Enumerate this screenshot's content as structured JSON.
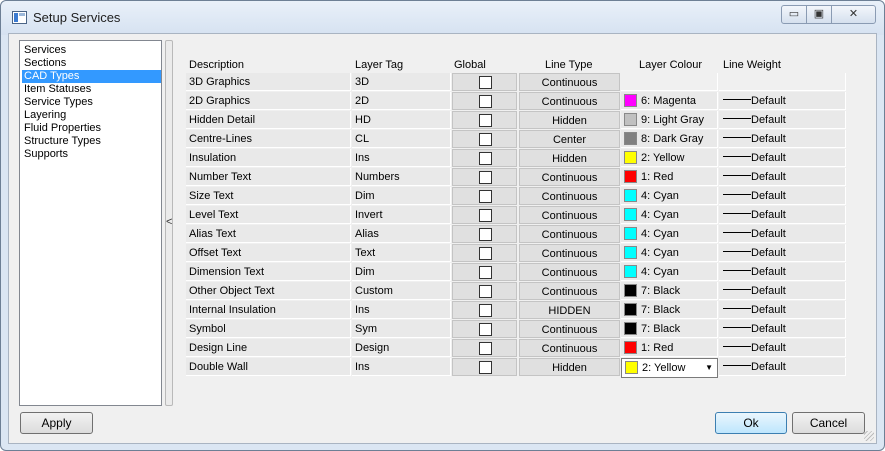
{
  "window": {
    "title": "Setup Services",
    "minimize_glyph": "▭",
    "maximize_glyph": "▣",
    "close_glyph": "✕",
    "icon": "window-app-icon"
  },
  "nav": {
    "items": [
      "Services",
      "Sections",
      "CAD Types",
      "Item Statuses",
      "Service Types",
      "Layering",
      "Fluid Properties",
      "Structure Types",
      "Supports"
    ],
    "selected": "CAD Types"
  },
  "splitter": {
    "glyph": "<"
  },
  "grid": {
    "headers": {
      "description": "Description",
      "layer_tag": "Layer Tag",
      "global": "Global",
      "line_type": "Line Type",
      "layer_colour": "Layer Colour",
      "line_weight": "Line Weight"
    },
    "rows": [
      {
        "description": "3D Graphics",
        "layer_tag": "3D",
        "line_type": "Continuous",
        "colour": "",
        "swatch": "",
        "weight": ""
      },
      {
        "description": "2D Graphics",
        "layer_tag": "2D",
        "line_type": "Continuous",
        "colour": "6: Magenta",
        "swatch": "#ff00ff",
        "weight": "Default"
      },
      {
        "description": "Hidden Detail",
        "layer_tag": "HD",
        "line_type": "Hidden",
        "colour": "9: Light Gray",
        "swatch": "#c0c0c0",
        "weight": "Default"
      },
      {
        "description": "Centre-Lines",
        "layer_tag": "CL",
        "line_type": "Center",
        "colour": "8: Dark Gray",
        "swatch": "#808080",
        "weight": "Default"
      },
      {
        "description": "Insulation",
        "layer_tag": "Ins",
        "line_type": "Hidden",
        "colour": "2: Yellow",
        "swatch": "#ffff00",
        "weight": "Default"
      },
      {
        "description": "Number Text",
        "layer_tag": "Numbers",
        "line_type": "Continuous",
        "colour": "1: Red",
        "swatch": "#ff0000",
        "weight": "Default"
      },
      {
        "description": "Size Text",
        "layer_tag": "Dim",
        "line_type": "Continuous",
        "colour": "4: Cyan",
        "swatch": "#00ffff",
        "weight": "Default"
      },
      {
        "description": "Level Text",
        "layer_tag": "Invert",
        "line_type": "Continuous",
        "colour": "4: Cyan",
        "swatch": "#00ffff",
        "weight": "Default"
      },
      {
        "description": "Alias Text",
        "layer_tag": "Alias",
        "line_type": "Continuous",
        "colour": "4: Cyan",
        "swatch": "#00ffff",
        "weight": "Default"
      },
      {
        "description": "Offset Text",
        "layer_tag": "Text",
        "line_type": "Continuous",
        "colour": "4: Cyan",
        "swatch": "#00ffff",
        "weight": "Default"
      },
      {
        "description": "Dimension Text",
        "layer_tag": "Dim",
        "line_type": "Continuous",
        "colour": "4: Cyan",
        "swatch": "#00ffff",
        "weight": "Default"
      },
      {
        "description": "Other Object Text",
        "layer_tag": "Custom",
        "line_type": "Continuous",
        "colour": "7: Black",
        "swatch": "#000000",
        "weight": "Default"
      },
      {
        "description": "Internal Insulation",
        "layer_tag": "Ins",
        "line_type": "HIDDEN",
        "colour": "7: Black",
        "swatch": "#000000",
        "weight": "Default"
      },
      {
        "description": "Symbol",
        "layer_tag": "Sym",
        "line_type": "Continuous",
        "colour": "7: Black",
        "swatch": "#000000",
        "weight": "Default"
      },
      {
        "description": "Design Line",
        "layer_tag": "Design",
        "line_type": "Continuous",
        "colour": "1: Red",
        "swatch": "#ff0000",
        "weight": "Default"
      },
      {
        "description": "Double Wall",
        "layer_tag": "Ins",
        "line_type": "Hidden",
        "colour": "2: Yellow",
        "swatch": "#ffff00",
        "weight": "Default",
        "dropdown_open": true
      }
    ]
  },
  "buttons": {
    "apply": "Apply",
    "ok": "Ok",
    "cancel": "Cancel"
  }
}
